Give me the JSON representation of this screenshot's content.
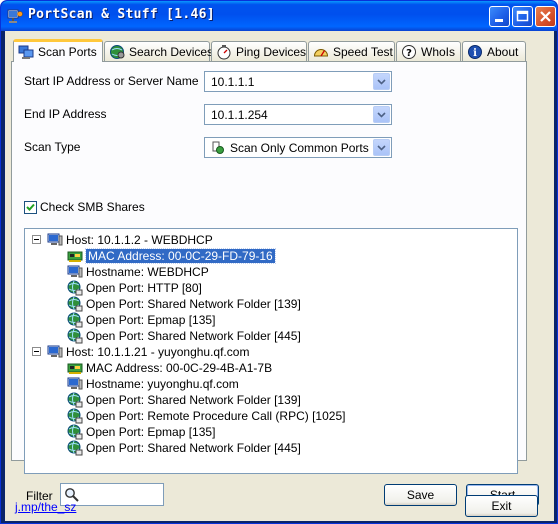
{
  "window": {
    "title": "PortScan & Stuff [1.46]"
  },
  "tabs": [
    {
      "label": "Scan Ports",
      "icon": "network-icon",
      "active": true
    },
    {
      "label": "Search Devices",
      "icon": "globe-icon",
      "active": false
    },
    {
      "label": "Ping Devices",
      "icon": "stopwatch-icon",
      "active": false
    },
    {
      "label": "Speed Test",
      "icon": "gauge-icon",
      "active": false
    },
    {
      "label": "WhoIs",
      "icon": "help-icon",
      "active": false
    },
    {
      "label": "About",
      "icon": "info-icon",
      "active": false
    }
  ],
  "form": {
    "start_label": "Start IP Address or Server Name",
    "start_value": "10.1.1.1",
    "end_label": "End IP Address",
    "end_value": "10.1.1.254",
    "scan_type_label": "Scan Type",
    "scan_type_value": "Scan Only Common Ports",
    "smb_label": "Check SMB Shares",
    "smb_checked": true
  },
  "results": [
    {
      "host": "Host: 10.1.1.2 - WEBDHCP",
      "children": [
        {
          "text": "MAC Address: 00-0C-29-FD-79-16",
          "icon": "network-card-icon",
          "selected": true
        },
        {
          "text": "Hostname: WEBDHCP",
          "icon": "computer-icon"
        },
        {
          "text": "Open Port: HTTP [80]",
          "icon": "globe-icon"
        },
        {
          "text": "Open Port: Shared Network Folder [139]",
          "icon": "globe-icon"
        },
        {
          "text": "Open Port: Epmap [135]",
          "icon": "globe-icon"
        },
        {
          "text": "Open Port: Shared Network Folder [445]",
          "icon": "globe-icon"
        }
      ]
    },
    {
      "host": "Host: 10.1.1.21 - yuyonghu.qf.com",
      "children": [
        {
          "text": "MAC Address: 00-0C-29-4B-A1-7B",
          "icon": "network-card-icon"
        },
        {
          "text": "Hostname: yuyonghu.qf.com",
          "icon": "computer-icon"
        },
        {
          "text": "Open Port: Shared Network Folder [139]",
          "icon": "globe-icon"
        },
        {
          "text": "Open Port: Remote Procedure Call (RPC) [1025]",
          "icon": "globe-icon"
        },
        {
          "text": "Open Port: Epmap [135]",
          "icon": "globe-icon"
        },
        {
          "text": "Open Port: Shared Network Folder [445]",
          "icon": "globe-icon"
        }
      ]
    }
  ],
  "filter": {
    "label": "Filter",
    "value": ""
  },
  "buttons": {
    "save": "Save",
    "start": "Start",
    "exit": "Exit"
  },
  "footer_link": "j.mp/the_sz",
  "colors": {
    "titlebar": "#0053ee",
    "selection": "#316ac5",
    "tab_highlight": "#ffc83c",
    "dialog_bg": "#ece9d8"
  }
}
